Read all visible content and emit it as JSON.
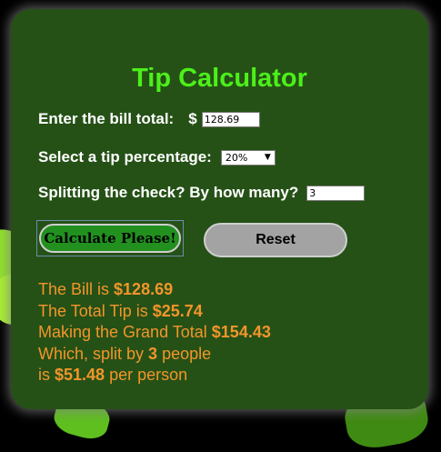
{
  "title": "Tip Calculator",
  "bill": {
    "label": "Enter the bill total:",
    "currency": "$",
    "value": "128.69"
  },
  "tip": {
    "label": "Select a tip percentage:",
    "selected": "20%"
  },
  "split": {
    "label": "Splitting the check? By how many?",
    "value": "3"
  },
  "buttons": {
    "calculate": "Calculate Please!",
    "reset": "Reset"
  },
  "results": {
    "bill_prefix": "The Bill is ",
    "bill_amount": "$128.69",
    "tip_prefix": "The Total Tip is ",
    "tip_amount": "$25.74",
    "grand_prefix": "Making the Grand Total ",
    "grand_amount": "$154.43",
    "split_prefix": "Which, split by ",
    "split_count": "3",
    "split_suffix": " people",
    "per_prefix": "is ",
    "per_amount": "$51.48",
    "per_suffix": " per person"
  },
  "colors": {
    "card": "#255116",
    "title": "#4cf01a",
    "results": "#f2952b",
    "calculate_button": "#22901f",
    "reset_button": "#a3a3a3"
  }
}
